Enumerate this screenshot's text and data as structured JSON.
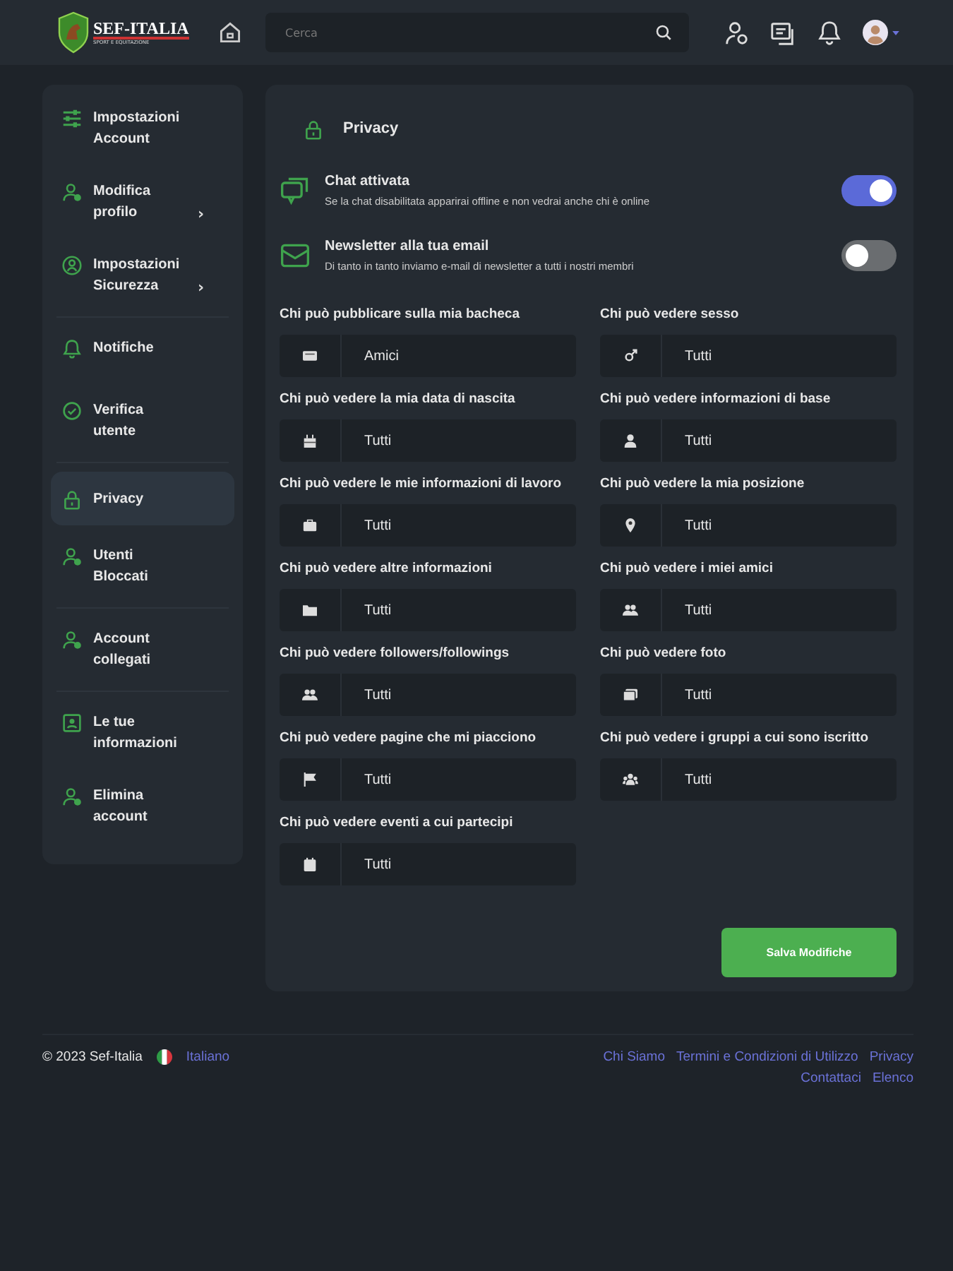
{
  "header": {
    "logo": {
      "title": "SEF-ITALIA",
      "subtitle": "SPORT E EQUITAZIONE"
    },
    "search": {
      "placeholder": "Cerca"
    }
  },
  "sidebar": {
    "groups": [
      {
        "items": [
          {
            "label": "Impostazioni Account",
            "selected": false
          },
          {
            "label": "Modifica profilo",
            "chevron": "›",
            "selected": false
          },
          {
            "label": "Impostazioni Sicurezza",
            "chevron": "›",
            "selected": false
          }
        ]
      },
      {
        "items": [
          {
            "label": "Notifiche",
            "selected": false
          },
          {
            "label": "Verifica utente",
            "selected": false
          }
        ]
      },
      {
        "items": [
          {
            "label": "Privacy",
            "selected": true
          },
          {
            "label": "Utenti Bloccati",
            "selected": false
          }
        ]
      },
      {
        "items": [
          {
            "label": "Account collegati",
            "selected": false
          }
        ]
      },
      {
        "items": [
          {
            "label": "Le tue informazioni",
            "selected": false
          },
          {
            "label": "Elimina account",
            "selected": false
          }
        ]
      }
    ]
  },
  "panel": {
    "title": "Privacy",
    "toggles": [
      {
        "title": "Chat attivata",
        "description": "Se la chat disabilitata apparirai offline e non vedrai anche chi è online",
        "on": true
      },
      {
        "title": "Newsletter alla tua email",
        "description": "Di tanto in tanto inviamo e-mail di newsletter a tutti i nostri membri",
        "on": false
      }
    ],
    "fields": [
      {
        "label": "Chi può pubblicare sulla mia bacheca",
        "value": "Amici"
      },
      {
        "label": "Chi può vedere sesso",
        "value": "Tutti"
      },
      {
        "label": "Chi può vedere la mia data di nascita",
        "value": "Tutti"
      },
      {
        "label": "Chi può vedere informazioni di base",
        "value": "Tutti"
      },
      {
        "label": "Chi può vedere le mie informazioni di lavoro",
        "value": "Tutti"
      },
      {
        "label": "Chi può vedere la mia posizione",
        "value": "Tutti"
      },
      {
        "label": "Chi può vedere altre informazioni",
        "value": "Tutti"
      },
      {
        "label": "Chi può vedere i miei amici",
        "value": "Tutti"
      },
      {
        "label": "Chi può vedere followers/followings",
        "value": "Tutti"
      },
      {
        "label": "Chi può vedere foto",
        "value": "Tutti"
      },
      {
        "label": "Chi può vedere pagine che mi piacciono",
        "value": "Tutti"
      },
      {
        "label": "Chi può vedere i gruppi a cui sono iscritto",
        "value": "Tutti"
      },
      {
        "label": "Chi può vedere eventi a cui partecipi",
        "value": "Tutti"
      }
    ],
    "save_button": "Salva Modifiche"
  },
  "footer": {
    "copyright": "© 2023 Sef-Italia",
    "language": "Italiano",
    "links": [
      "Chi Siamo",
      "Termini e Condizioni di Utilizzo",
      "Privacy",
      "Contattaci",
      "Elenco"
    ]
  }
}
